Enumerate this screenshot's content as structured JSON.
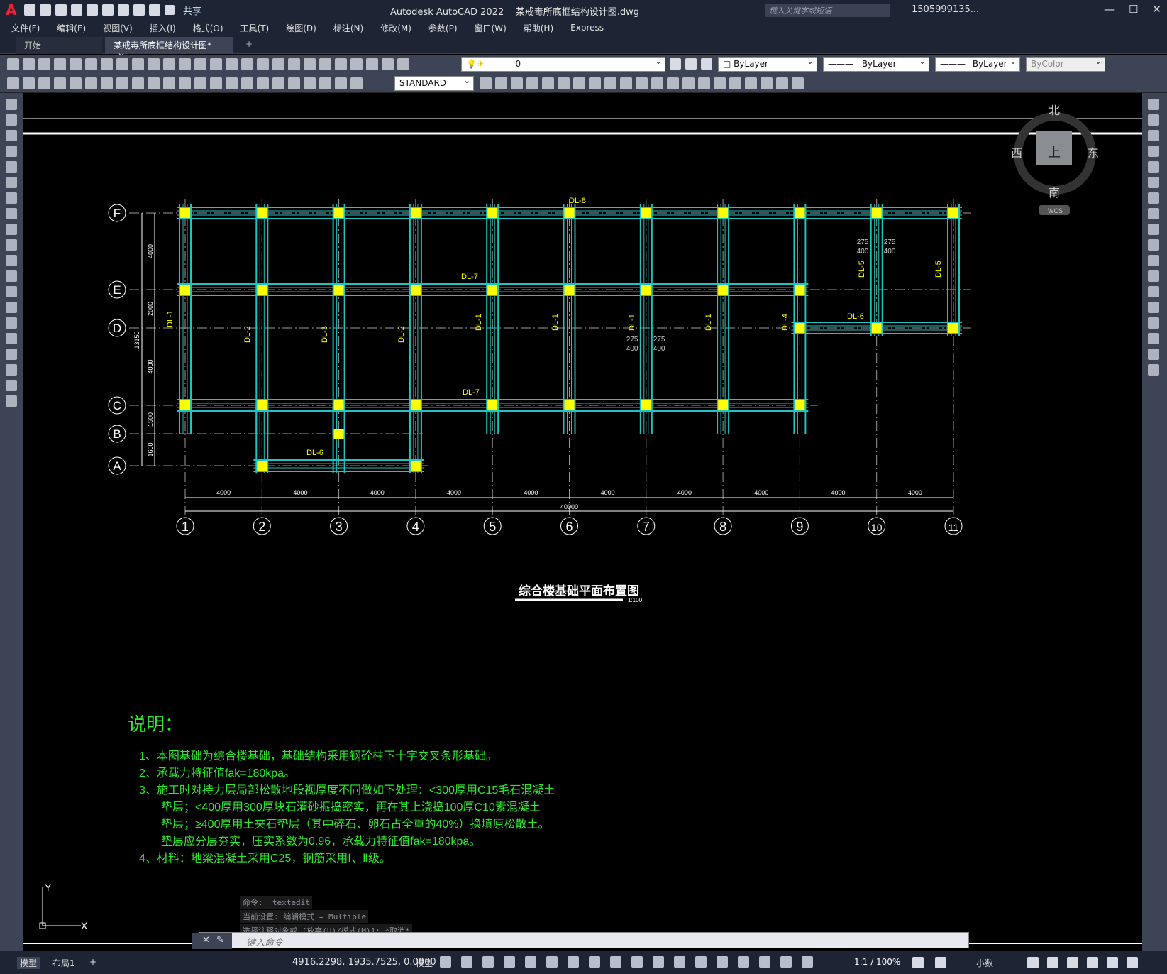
{
  "app": {
    "title": "Autodesk AutoCAD 2022    某戒毒所底框结构设计图.dwg",
    "share": "共享",
    "search_placeholder": "键入关键字或短语",
    "user": "1505999135...",
    "logo": "A"
  },
  "menu": [
    "文件(F)",
    "编辑(E)",
    "视图(V)",
    "插入(I)",
    "格式(O)",
    "工具(T)",
    "绘图(D)",
    "标注(N)",
    "修改(M)",
    "参数(P)",
    "窗口(W)",
    "帮助(H)",
    "Express"
  ],
  "tabs": {
    "start": "开始",
    "doc": "某戒毒所底框结构设计图*",
    "doc_close": "✕",
    "add": "+"
  },
  "toolbar": {
    "layer": "0",
    "color": "ByLayer",
    "linetype": "ByLayer",
    "lineweight": "ByLayer",
    "plotstyle": "ByColor",
    "textstyle": "STANDARD"
  },
  "viewcube": {
    "north": "北",
    "south": "南",
    "east": "东",
    "west": "西",
    "top": "上",
    "wcs": "WCS"
  },
  "drawing": {
    "title": "综合楼基础平面布置图",
    "scale": "1:100",
    "axes_row": [
      "F",
      "E",
      "D",
      "C",
      "B",
      "A"
    ],
    "axes_col": [
      "1",
      "2",
      "3",
      "4",
      "5",
      "6",
      "7",
      "8",
      "9",
      "10",
      "11"
    ],
    "spans": [
      "4000",
      "4000",
      "4000",
      "4000",
      "4000",
      "4000",
      "4000",
      "4000",
      "4000",
      "4000"
    ],
    "total": "40000",
    "total_y": "13150",
    "vspans": [
      "4000",
      "2000",
      "4000",
      "1500",
      "1650"
    ],
    "beam_labels": [
      "DL-8",
      "DL-7",
      "DL-7",
      "DL-1",
      "DL-2",
      "DL-3",
      "DL-2",
      "DL-1",
      "DL-1",
      "DL-1",
      "DL-1",
      "DL-4",
      "DL-5",
      "DL-5",
      "DL-6",
      "DL-6"
    ],
    "notes_title": "说明：",
    "notes": [
      "1、本图基础为综合楼基础，基础结构采用钢砼柱下十字交叉条形基础。",
      "2、承载力特征值fak=180kpa。",
      "3、施工时对持力层局部松散地段视厚度不同做如下处理：<300厚用C15毛石混凝土",
      "垫层；<400厚用300厚块石灌砂振捣密实，再在其上浇捣100厚C10素混凝土",
      "垫层；≥400厚用土夹石垫层（其中碎石、卵石占全重的40%）换填原松散土。",
      "垫层应分层夯实，压实系数为0.96，承载力特征值fak=180kpa。",
      "4、材料：地梁混凝土采用C25，钢筋采用Ⅰ、Ⅱ级。"
    ],
    "dims_small": [
      "275",
      "275",
      "400",
      "400"
    ]
  },
  "ucs": {
    "x": "X",
    "y": "Y"
  },
  "command": {
    "history": [
      "命令: _textedit",
      "当前设置: 编辑模式 = Multiple",
      "选择注释对象或 [放弃(U)/模式(M)]: *取消*"
    ],
    "placeholder": "键入命令"
  },
  "status": {
    "model_tab": "模型",
    "layout_tab": "布局1",
    "add": "+",
    "coords": "4916.2298, 1935.7525, 0.0000",
    "mode": "模型",
    "scale": "1:1 / 100%",
    "units": "小数"
  },
  "colors": {
    "cyan": "#1fc3c3",
    "yellow": "#ffff00",
    "green": "#2ee82e",
    "gray": "#9a9a9a",
    "bg": "#000000",
    "ui_dark": "#1d2433",
    "ui_mid": "#3d4455"
  }
}
